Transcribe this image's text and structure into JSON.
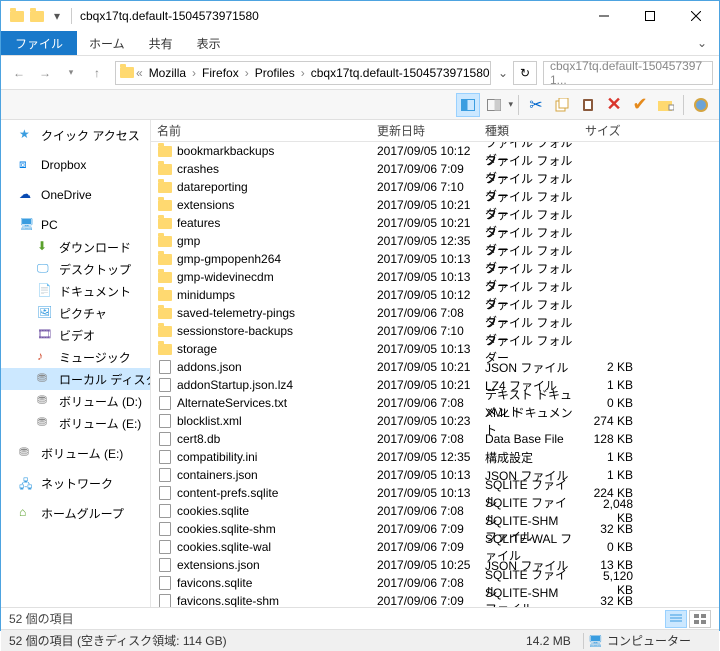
{
  "window": {
    "title": "cbqx17tq.default-1504573971580"
  },
  "menu": {
    "file": "ファイル",
    "home": "ホーム",
    "share": "共有",
    "view": "表示"
  },
  "breadcrumb": [
    "Mozilla",
    "Firefox",
    "Profiles",
    "cbqx17tq.default-1504573971580"
  ],
  "search": {
    "placeholder": "cbqx17tq.default-150457397 1..."
  },
  "columns": {
    "name": "名前",
    "date": "更新日時",
    "type": "種類",
    "size": "サイズ"
  },
  "sidebar": [
    {
      "label": "クイック アクセス",
      "icon": "star",
      "indent": 0
    },
    {
      "label": "Dropbox",
      "icon": "dropbox",
      "indent": 0,
      "gap": true
    },
    {
      "label": "OneDrive",
      "icon": "onedrive",
      "indent": 0,
      "gap": true
    },
    {
      "label": "PC",
      "icon": "pc",
      "indent": 0,
      "gap": true
    },
    {
      "label": "ダウンロード",
      "icon": "download",
      "indent": 1
    },
    {
      "label": "デスクトップ",
      "icon": "desktop",
      "indent": 1
    },
    {
      "label": "ドキュメント",
      "icon": "document",
      "indent": 1
    },
    {
      "label": "ピクチャ",
      "icon": "picture",
      "indent": 1
    },
    {
      "label": "ビデオ",
      "icon": "video",
      "indent": 1
    },
    {
      "label": "ミュージック",
      "icon": "music",
      "indent": 1
    },
    {
      "label": "ローカル ディスク (C:)",
      "icon": "hdd",
      "indent": 1,
      "selected": true
    },
    {
      "label": "ボリューム (D:)",
      "icon": "hdd",
      "indent": 1
    },
    {
      "label": "ボリューム (E:)",
      "icon": "hdd",
      "indent": 1
    },
    {
      "label": "ボリューム (E:)",
      "icon": "hdd",
      "indent": 0,
      "gap": true
    },
    {
      "label": "ネットワーク",
      "icon": "network",
      "indent": 0,
      "gap": true
    },
    {
      "label": "ホームグループ",
      "icon": "homegroup",
      "indent": 0,
      "gap": true
    }
  ],
  "files": [
    {
      "name": "bookmarkbackups",
      "date": "2017/09/05 10:12",
      "type": "ファイル フォルダー",
      "size": "",
      "folder": true
    },
    {
      "name": "crashes",
      "date": "2017/09/06 7:09",
      "type": "ファイル フォルダー",
      "size": "",
      "folder": true
    },
    {
      "name": "datareporting",
      "date": "2017/09/06 7:10",
      "type": "ファイル フォルダー",
      "size": "",
      "folder": true
    },
    {
      "name": "extensions",
      "date": "2017/09/05 10:21",
      "type": "ファイル フォルダー",
      "size": "",
      "folder": true
    },
    {
      "name": "features",
      "date": "2017/09/05 10:21",
      "type": "ファイル フォルダー",
      "size": "",
      "folder": true
    },
    {
      "name": "gmp",
      "date": "2017/09/05 12:35",
      "type": "ファイル フォルダー",
      "size": "",
      "folder": true
    },
    {
      "name": "gmp-gmpopenh264",
      "date": "2017/09/05 10:13",
      "type": "ファイル フォルダー",
      "size": "",
      "folder": true
    },
    {
      "name": "gmp-widevinecdm",
      "date": "2017/09/05 10:13",
      "type": "ファイル フォルダー",
      "size": "",
      "folder": true
    },
    {
      "name": "minidumps",
      "date": "2017/09/05 10:12",
      "type": "ファイル フォルダー",
      "size": "",
      "folder": true
    },
    {
      "name": "saved-telemetry-pings",
      "date": "2017/09/06 7:08",
      "type": "ファイル フォルダー",
      "size": "",
      "folder": true
    },
    {
      "name": "sessionstore-backups",
      "date": "2017/09/06 7:10",
      "type": "ファイル フォルダー",
      "size": "",
      "folder": true
    },
    {
      "name": "storage",
      "date": "2017/09/05 10:13",
      "type": "ファイル フォルダー",
      "size": "",
      "folder": true
    },
    {
      "name": "addons.json",
      "date": "2017/09/05 10:21",
      "type": "JSON ファイル",
      "size": "2 KB"
    },
    {
      "name": "addonStartup.json.lz4",
      "date": "2017/09/05 10:21",
      "type": "LZ4 ファイル",
      "size": "1 KB"
    },
    {
      "name": "AlternateServices.txt",
      "date": "2017/09/06 7:08",
      "type": "テキスト ドキュメント",
      "size": "0 KB"
    },
    {
      "name": "blocklist.xml",
      "date": "2017/09/05 10:23",
      "type": "XML ドキュメント",
      "size": "274 KB"
    },
    {
      "name": "cert8.db",
      "date": "2017/09/06 7:08",
      "type": "Data Base File",
      "size": "128 KB"
    },
    {
      "name": "compatibility.ini",
      "date": "2017/09/05 12:35",
      "type": "構成設定",
      "size": "1 KB"
    },
    {
      "name": "containers.json",
      "date": "2017/09/05 10:13",
      "type": "JSON ファイル",
      "size": "1 KB"
    },
    {
      "name": "content-prefs.sqlite",
      "date": "2017/09/05 10:13",
      "type": "SQLITE ファイル",
      "size": "224 KB"
    },
    {
      "name": "cookies.sqlite",
      "date": "2017/09/06 7:08",
      "type": "SQLITE ファイル",
      "size": "2,048 KB"
    },
    {
      "name": "cookies.sqlite-shm",
      "date": "2017/09/06 7:09",
      "type": "SQLITE-SHM ファイル",
      "size": "32 KB"
    },
    {
      "name": "cookies.sqlite-wal",
      "date": "2017/09/06 7:09",
      "type": "SQLITE-WAL ファイル",
      "size": "0 KB"
    },
    {
      "name": "extensions.json",
      "date": "2017/09/05 10:25",
      "type": "JSON ファイル",
      "size": "13 KB"
    },
    {
      "name": "favicons.sqlite",
      "date": "2017/09/06 7:08",
      "type": "SQLITE ファイル",
      "size": "5,120 KB"
    },
    {
      "name": "favicons.sqlite-shm",
      "date": "2017/09/06 7:09",
      "type": "SQLITE-SHM ファイル",
      "size": "32 KB"
    }
  ],
  "status1": {
    "count": "52 個の項目"
  },
  "status2": {
    "left": "52 個の項目 (空きディスク領域: 114 GB)",
    "size": "14.2 MB",
    "computer": "コンピューター"
  }
}
